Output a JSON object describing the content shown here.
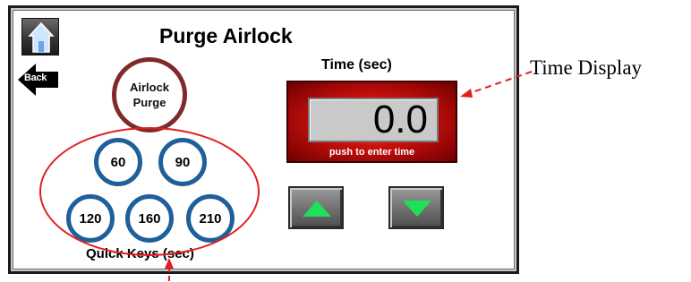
{
  "screen": {
    "title": "Purge Airlock",
    "home_icon": "home-icon",
    "back_label": "Back"
  },
  "purge_button": {
    "line1": "Airlock",
    "line2": "Purge"
  },
  "quick_keys": {
    "label": "Quick Keys (sec)",
    "keys": [
      "60",
      "90",
      "120",
      "160",
      "210"
    ]
  },
  "time": {
    "label": "Time (sec)",
    "value": "0.0",
    "hint": "push to enter time"
  },
  "controls": {
    "up_icon": "triangle-up-icon",
    "down_icon": "triangle-down-icon"
  },
  "annotations": {
    "time_display": "Time Display"
  },
  "colors": {
    "purge_ring": "#7f2a2a",
    "quick_ring": "#1f5f9a",
    "time_panel": "#c8100c",
    "arrow_green": "#1ee05a",
    "annotation_red": "#e21e1e"
  }
}
